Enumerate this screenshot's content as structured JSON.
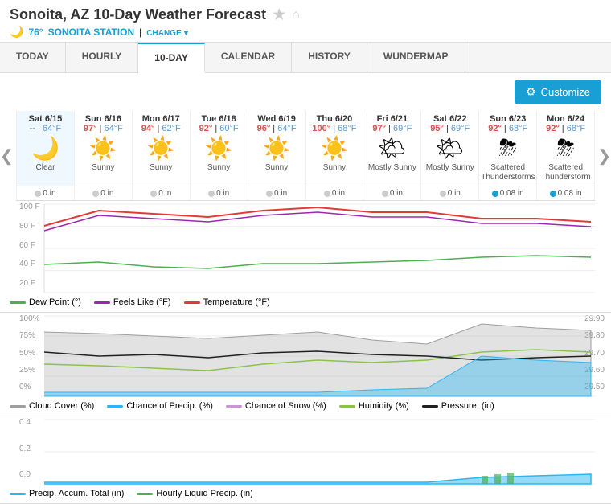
{
  "header": {
    "title": "Sonoita, AZ 10-Day Weather Forecast",
    "temp": "76°",
    "station": "SONOITA STATION",
    "change": "CHANGE",
    "star": "★",
    "home": "⌂"
  },
  "nav": {
    "tabs": [
      "TODAY",
      "HOURLY",
      "10-DAY",
      "CALENDAR",
      "HISTORY",
      "WUNDERMAP"
    ],
    "active": "10-DAY"
  },
  "toolbar": {
    "customize_label": "Customize",
    "gear_icon": "⚙"
  },
  "forecast": {
    "days": [
      {
        "label": "Sat 6/15",
        "high": "--",
        "low": "64°F",
        "icon": "🌙",
        "desc": "Clear",
        "precip": "0 in",
        "precip_highlight": false
      },
      {
        "label": "Sun 6/16",
        "high": "97°",
        "low": "64°F",
        "icon": "☀️",
        "desc": "Sunny",
        "precip": "0 in",
        "precip_highlight": false
      },
      {
        "label": "Mon 6/17",
        "high": "94°",
        "low": "62°F",
        "icon": "☀️",
        "desc": "Sunny",
        "precip": "0 in",
        "precip_highlight": false
      },
      {
        "label": "Tue 6/18",
        "high": "92°",
        "low": "60°F",
        "icon": "☀️",
        "desc": "Sunny",
        "precip": "0 in",
        "precip_highlight": false
      },
      {
        "label": "Wed 6/19",
        "high": "96°",
        "low": "64°F",
        "icon": "☀️",
        "desc": "Sunny",
        "precip": "0 in",
        "precip_highlight": false
      },
      {
        "label": "Thu 6/20",
        "high": "100°",
        "low": "68°F",
        "icon": "☀️",
        "desc": "Sunny",
        "precip": "0 in",
        "precip_highlight": false
      },
      {
        "label": "Fri 6/21",
        "high": "97°",
        "low": "69°F",
        "icon": "🌤",
        "desc": "Mostly Sunny",
        "precip": "0 in",
        "precip_highlight": false
      },
      {
        "label": "Sat 6/22",
        "high": "95°",
        "low": "69°F",
        "icon": "🌤",
        "desc": "Mostly Sunny",
        "precip": "0 in",
        "precip_highlight": false
      },
      {
        "label": "Sun 6/23",
        "high": "92°",
        "low": "68°F",
        "icon": "⛈",
        "desc": "Scattered Thunderstorms",
        "precip": "0.08 in",
        "precip_highlight": true
      },
      {
        "label": "Mon 6/24",
        "high": "92°",
        "low": "68°F",
        "icon": "⛈",
        "desc": "Scattered Thunderstorm",
        "precip": "0.08 in",
        "precip_highlight": true
      }
    ]
  },
  "chart1": {
    "y_labels": [
      "100 F",
      "80 F",
      "60 F",
      "40 F",
      "20 F"
    ],
    "legend": [
      {
        "label": "Dew Point (°)",
        "color": "#4caf50"
      },
      {
        "label": "Feels Like (°F)",
        "color": "#9c27b0"
      },
      {
        "label": "Temperature (°F)",
        "color": "#e53935"
      }
    ]
  },
  "chart2": {
    "y_labels": [
      "100%",
      "75%",
      "50%",
      "25%",
      "0%"
    ],
    "y_labels_right": [
      "29.90",
      "29.80",
      "29.70",
      "29.60",
      "29.50"
    ],
    "legend": [
      {
        "label": "Cloud Cover (%)",
        "color": "#9e9e9e"
      },
      {
        "label": "Chance of Precip. (%)",
        "color": "#29b6f6"
      },
      {
        "label": "Chance of Snow (%)",
        "color": "#ce93d8"
      },
      {
        "label": "Humidity (%)",
        "color": "#8bc34a"
      },
      {
        "label": "Pressure. (in)",
        "color": "#212121"
      }
    ]
  },
  "chart3": {
    "y_labels": [
      "0.4",
      "0.2",
      "0.0"
    ],
    "legend": [
      {
        "label": "Precip. Accum. Total (in)",
        "color": "#29b6f6"
      },
      {
        "label": "Hourly Liquid Precip. (in)",
        "color": "#4caf50"
      }
    ]
  }
}
